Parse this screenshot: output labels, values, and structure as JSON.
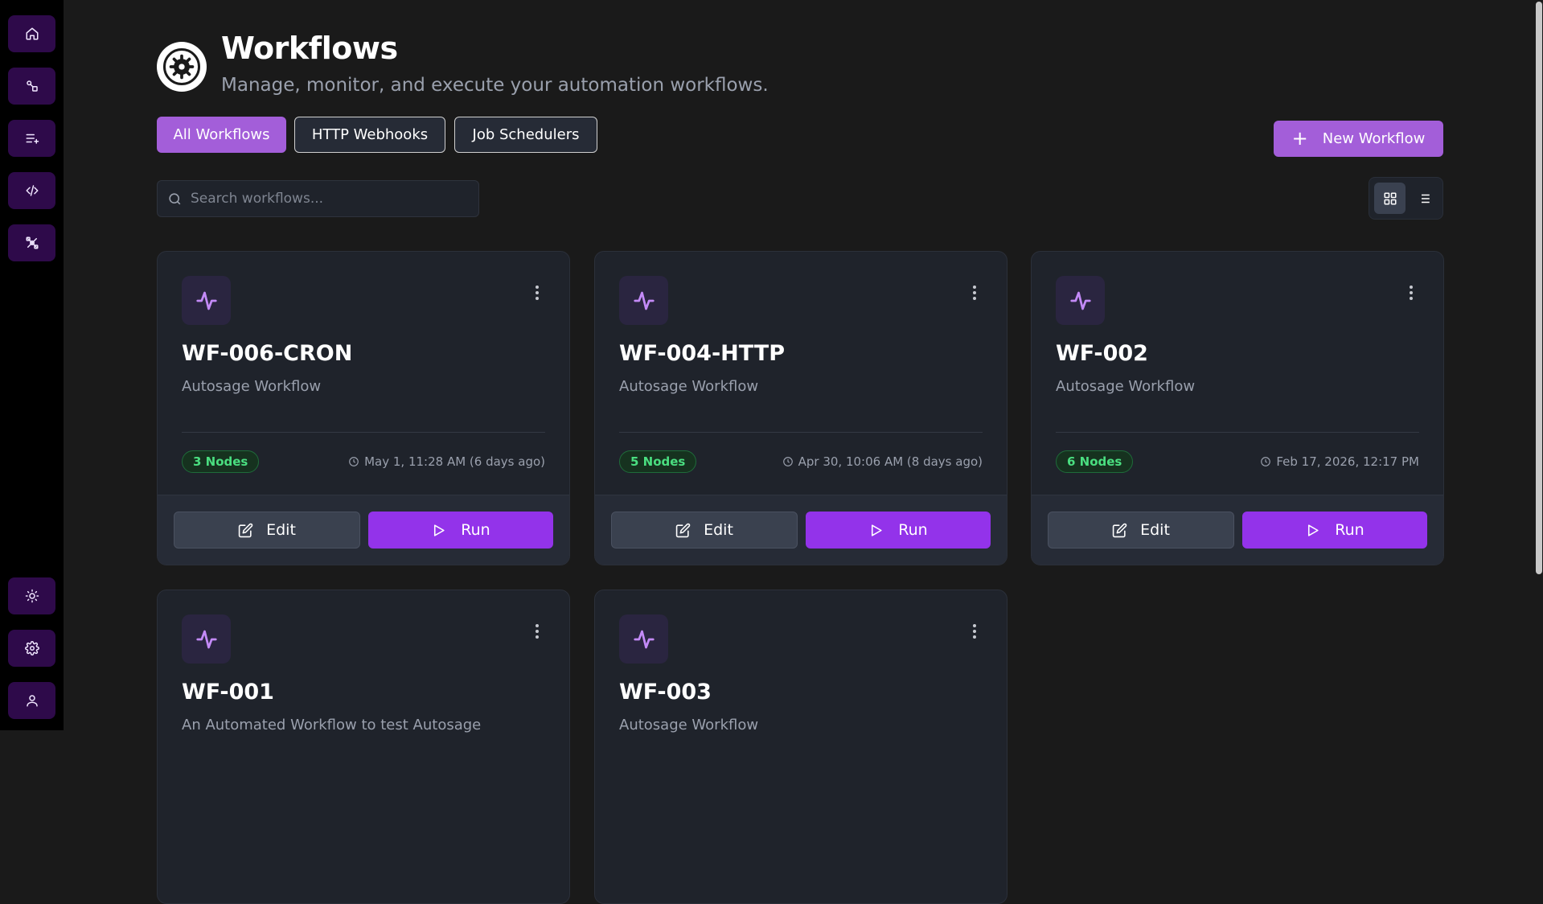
{
  "header": {
    "title": "Workflows",
    "subtitle": "Manage, monitor, and execute your automation workflows."
  },
  "tabs": [
    {
      "label": "All Workflows",
      "active": true
    },
    {
      "label": "HTTP Webhooks",
      "active": false
    },
    {
      "label": "Job Schedulers",
      "active": false
    }
  ],
  "actions": {
    "new_workflow_label": "New Workflow"
  },
  "search": {
    "placeholder": "Search workflows...",
    "value": ""
  },
  "view_toggle": {
    "selected": "grid",
    "options": [
      "grid-icon",
      "list-icon"
    ]
  },
  "sidebar": {
    "top_items": [
      "home-icon",
      "workflow-nodes-icon",
      "queue-add-icon",
      "code-icon",
      "integrations-icon"
    ],
    "bottom_items": [
      "sun-icon",
      "gear-icon",
      "user-icon"
    ]
  },
  "cards": [
    {
      "title": "WF-006-CRON",
      "description": "Autosage Workflow",
      "nodes": "3 Nodes",
      "date": "May 1, 11:28 AM (6 days ago)",
      "edit_label": "Edit",
      "run_label": "Run"
    },
    {
      "title": "WF-004-HTTP",
      "description": "Autosage Workflow",
      "nodes": "5 Nodes",
      "date": "Apr 30, 10:06 AM (8 days ago)",
      "edit_label": "Edit",
      "run_label": "Run"
    },
    {
      "title": "WF-002",
      "description": "Autosage Workflow",
      "nodes": "6 Nodes",
      "date": "Feb 17, 2026, 12:17 PM",
      "edit_label": "Edit",
      "run_label": "Run"
    },
    {
      "title": "WF-001",
      "description": "An Automated Workflow to test Autosage"
    },
    {
      "title": "WF-003",
      "description": "Autosage Workflow"
    }
  ],
  "colors": {
    "accent": "#a35ed9",
    "run_button": "#9333ea",
    "badge_green": "#4ade80",
    "background": "#1a1a1a",
    "card": "#1f232b"
  }
}
